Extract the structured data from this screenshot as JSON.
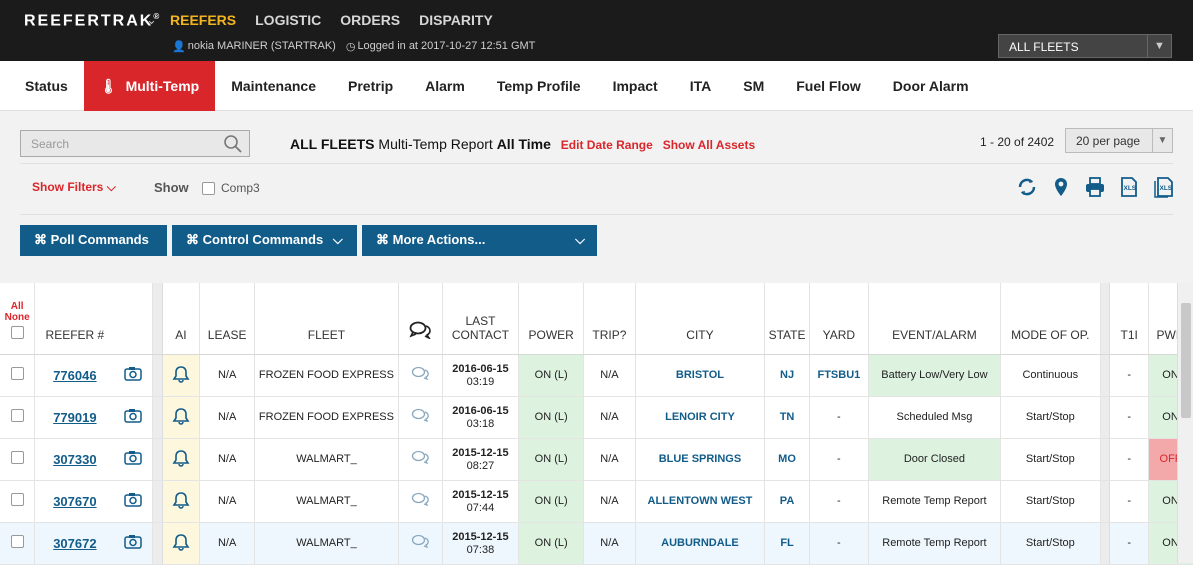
{
  "app": {
    "brand": "REEFERTRAK",
    "brand_mark": "®",
    "nav": [
      "REEFERS",
      "LOGISTIC",
      "ORDERS",
      "DISPARITY"
    ],
    "user": "nokia MARINER (STARTRAK)",
    "login": "Logged in at 2017-10-27 12:51 GMT",
    "fleet_select": "ALL FLEETS"
  },
  "tabs": [
    "Status",
    "Multi-Temp",
    "Maintenance",
    "Pretrip",
    "Alarm",
    "Temp Profile",
    "Impact",
    "ITA",
    "SM",
    "Fuel Flow",
    "Door Alarm"
  ],
  "controls": {
    "search_placeholder": "Search",
    "report_fleet": "ALL FLEETS",
    "report_name": "Multi-Temp Report",
    "report_range": "All Time",
    "edit_date_range": "Edit Date Range",
    "show_all_assets": "Show All Assets",
    "page_count": "1 - 20 of 2402",
    "per_page": "20 per page",
    "show_filters": "Show Filters",
    "show_label": "Show",
    "comp3_label": "Comp3",
    "poll_commands": "⌘ Poll Commands",
    "control_commands": "⌘ Control Commands",
    "more_actions": "⌘ More Actions..."
  },
  "table": {
    "all_label": "All",
    "none_label": "None",
    "headers": {
      "reefer": "REEFER #",
      "ai": "AI",
      "lease": "LEASE",
      "fleet": "FLEET",
      "last_contact_1": "LAST",
      "last_contact_2": "CONTACT",
      "power": "POWER",
      "trip": "TRIP?",
      "city": "CITY",
      "state": "STATE",
      "yard": "YARD",
      "event": "EVENT/ALARM",
      "mode": "MODE OF OP.",
      "t1": "T1I",
      "pwr": "PWR"
    },
    "rows": [
      {
        "reefer": "776046",
        "lease": "N/A",
        "fleet": "FROZEN FOOD EXPRESS",
        "date": "2016-06-15",
        "time": "03:19",
        "power": "ON (L)",
        "trip": "N/A",
        "city": "BRISTOL",
        "state": "NJ",
        "yard": "FTSBU1",
        "event": "Battery Low/Very Low",
        "mode": "Continuous",
        "t1": "-",
        "pwr": "ON"
      },
      {
        "reefer": "779019",
        "lease": "N/A",
        "fleet": "FROZEN FOOD EXPRESS",
        "date": "2016-06-15",
        "time": "03:18",
        "power": "ON (L)",
        "trip": "N/A",
        "city": "LENOIR CITY",
        "state": "TN",
        "yard": "-",
        "event": "Scheduled Msg",
        "mode": "Start/Stop",
        "t1": "-",
        "pwr": "ON"
      },
      {
        "reefer": "307330",
        "lease": "N/A",
        "fleet": "WALMART_",
        "date": "2015-12-15",
        "time": "08:27",
        "power": "ON (L)",
        "trip": "N/A",
        "city": "BLUE SPRINGS",
        "state": "MO",
        "yard": "-",
        "event": "Door Closed",
        "mode": "Start/Stop",
        "t1": "-",
        "pwr": "OFF"
      },
      {
        "reefer": "307670",
        "lease": "N/A",
        "fleet": "WALMART_",
        "date": "2015-12-15",
        "time": "07:44",
        "power": "ON (L)",
        "trip": "N/A",
        "city": "ALLENTOWN WEST",
        "state": "PA",
        "yard": "-",
        "event": "Remote Temp Report",
        "mode": "Start/Stop",
        "t1": "-",
        "pwr": "ON"
      },
      {
        "reefer": "307672",
        "lease": "N/A",
        "fleet": "WALMART_",
        "date": "2015-12-15",
        "time": "07:38",
        "power": "ON (L)",
        "trip": "N/A",
        "city": "AUBURNDALE",
        "state": "FL",
        "yard": "-",
        "event": "Remote Temp Report",
        "mode": "Start/Stop",
        "t1": "-",
        "pwr": "ON"
      }
    ]
  },
  "colors": {
    "accent_red": "#d9262b",
    "nav_active": "#f2b51d",
    "button_blue": "#125c8a"
  }
}
